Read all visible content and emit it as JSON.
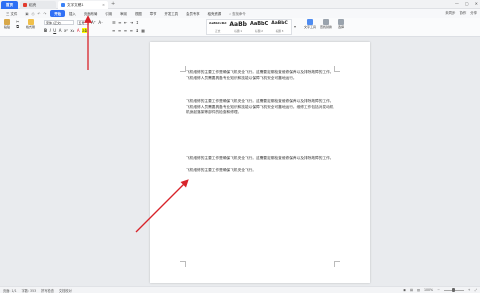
{
  "titlebar": {
    "home_tab": "首页",
    "wps_tab": "稻壳",
    "doc_tab": "文字文稿1",
    "add_tab": "+"
  },
  "menu": {
    "file": "三 文件",
    "items": [
      "开始",
      "插入",
      "页面布局",
      "引用",
      "审阅",
      "视图",
      "章节",
      "开发工具",
      "会员专享",
      "稻壳资源"
    ],
    "active": "开始",
    "search": "查找命令",
    "right": [
      "未同步",
      "协作",
      "分享"
    ]
  },
  "ribbon": {
    "paste": "粘贴",
    "format_painter": "格式刷",
    "font_name": "宋体 (正文)",
    "font_size": "五号",
    "styles": [
      {
        "sample": "AaBbCcDd",
        "name": "正文"
      },
      {
        "sample": "AaBb",
        "name": "标题 1"
      },
      {
        "sample": "AaBbC",
        "name": "标题 2"
      },
      {
        "sample": "AaBbC",
        "name": "标题 3"
      }
    ],
    "text_tools": "文字工具",
    "find_replace": "查找替换",
    "select": "选择"
  },
  "document": {
    "paragraphs": [
      "飞机维修的主要工作是确保飞机安全飞行。这需要定期检查维修保养以及排除故障的工作。飞机维修人员需要具备专业知识和技能以保障飞机安全可靠地运行。",
      "飞机维修的主要工作是确保飞机安全飞行。这需要定期检查维修保养以及排除故障的工作。飞机维修人员需要具备专业知识和技能以保障飞机安全可靠地运行。维修工作包括对发动机机身起落架等部件的检查和修理。",
      "飞机维修的主要工作是确保飞机安全飞行。这需要定期检查维修保养以及排除故障的工作。",
      "飞机维修的主要工作是确保飞机安全飞行。"
    ]
  },
  "statusbar": {
    "page": "页面: 1/1",
    "words": "字数: 353",
    "spell": "拼写检查",
    "doc_check": "文档校对",
    "zoom": "100%"
  },
  "zoom_level": 0.5
}
